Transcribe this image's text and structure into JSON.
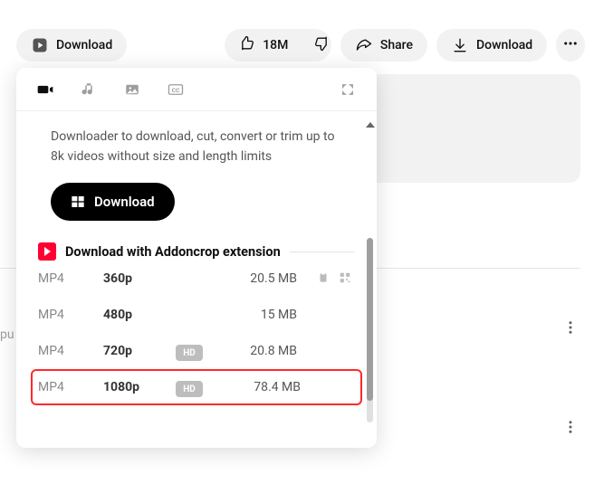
{
  "actionbar": {
    "download_label": "Download",
    "likes": "18M",
    "share_label": "Share",
    "download2_label": "Download"
  },
  "popup": {
    "desc": "Downloader to download, cut, convert or trim up to 8k videos without size and length limits",
    "big_download_label": "Download",
    "section_title": "Download with Addoncrop extension",
    "rows": [
      {
        "fmt": "MP4",
        "res": "360p",
        "hd": "",
        "size": "20.5 MB",
        "extras": true,
        "hl": false
      },
      {
        "fmt": "MP4",
        "res": "480p",
        "hd": "",
        "size": "15 MB",
        "extras": false,
        "hl": false
      },
      {
        "fmt": "MP4",
        "res": "720p",
        "hd": "HD",
        "size": "20.8 MB",
        "extras": false,
        "hl": false
      },
      {
        "fmt": "MP4",
        "res": "1080p",
        "hd": "HD",
        "size": "78.4 MB",
        "extras": false,
        "hl": true
      }
    ]
  },
  "side": {
    "pu": "pu"
  }
}
